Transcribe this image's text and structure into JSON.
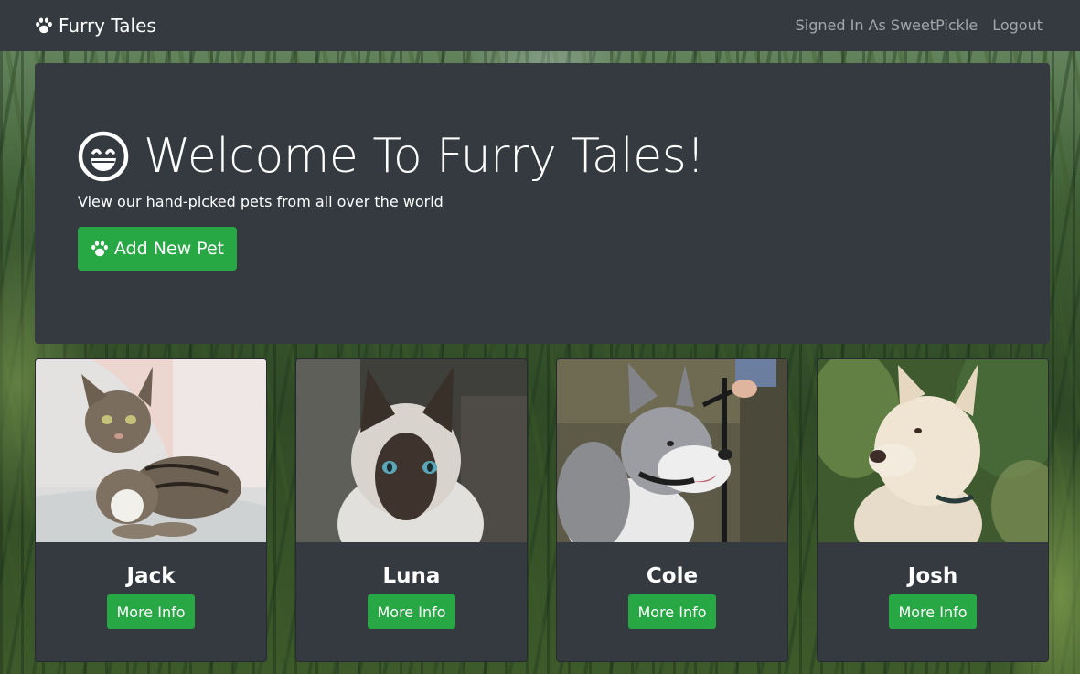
{
  "navbar": {
    "brand_icon": "paw-icon",
    "brand": "Furry Tales",
    "signed_in": "Signed In As SweetPickle",
    "logout": "Logout"
  },
  "jumbotron": {
    "icon": "grinning-face-icon",
    "title": "Welcome To Furry Tales!",
    "subtitle": "View our hand-picked pets from all over the world",
    "add_button_icon": "paw-icon",
    "add_button": "Add New Pet"
  },
  "pets": [
    {
      "name": "Jack",
      "button": "More Info",
      "image": "tabby-cat-photo"
    },
    {
      "name": "Luna",
      "button": "More Info",
      "image": "siamese-cat-photo"
    },
    {
      "name": "Cole",
      "button": "More Info",
      "image": "husky-dog-photo"
    },
    {
      "name": "Josh",
      "button": "More Info",
      "image": "white-dog-photo"
    }
  ],
  "colors": {
    "navbar": "#343a40",
    "accent_green": "#28a745",
    "nav_link": "rgba(255,255,255,0.55)"
  }
}
